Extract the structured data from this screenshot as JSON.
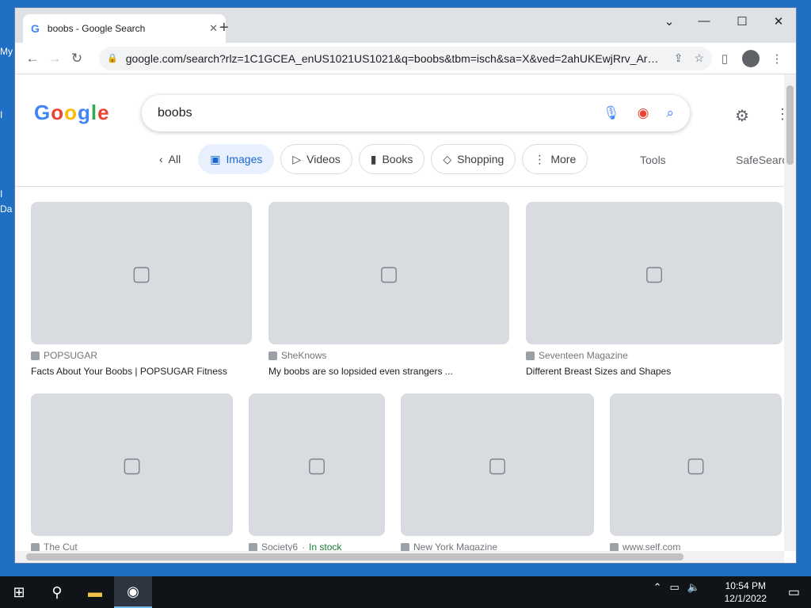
{
  "desktop": {
    "icon_labels": [
      "My",
      "I",
      "I",
      "Da"
    ]
  },
  "browser": {
    "tab_title": "boobs - Google Search",
    "tab_favicon": "G",
    "url": "google.com/search?rlz=1C1GCEA_enUS1021US1021&q=boobs&tbm=isch&sa=X&ved=2ahUKEwjRrv_ArN..."
  },
  "search": {
    "logo_text": "Google",
    "query": "boobs",
    "chips": [
      {
        "label": "All",
        "icon": "chevron-left-icon"
      },
      {
        "label": "Images",
        "icon": "image-icon",
        "active": true
      },
      {
        "label": "Videos",
        "icon": "play-icon"
      },
      {
        "label": "Books",
        "icon": "book-icon"
      },
      {
        "label": "Shopping",
        "icon": "tag-icon"
      },
      {
        "label": "More",
        "icon": "kebab-icon"
      }
    ],
    "tools": "Tools",
    "safesearch": "SafeSearch"
  },
  "results": [
    {
      "source": "POPSUGAR",
      "caption": "Facts About Your Boobs | POPSUGAR Fitness"
    },
    {
      "source": "SheKnows",
      "caption": "My boobs are so lopsided even strangers ..."
    },
    {
      "source": "Seventeen Magazine",
      "caption": "Different Breast Sizes and Shapes"
    },
    {
      "source": "The Cut",
      "caption": ""
    },
    {
      "source": "Society6",
      "status": "In stock",
      "caption": ""
    },
    {
      "source": "New York Magazine",
      "caption": ""
    },
    {
      "source": "www.self.com",
      "caption": ""
    }
  ],
  "taskbar": {
    "time": "10:54 PM",
    "date": "12/1/2022"
  },
  "colors": {
    "accent": "#1967d2",
    "chip_active_bg": "#e8f0fe",
    "desktop": "#1f6fc4"
  }
}
